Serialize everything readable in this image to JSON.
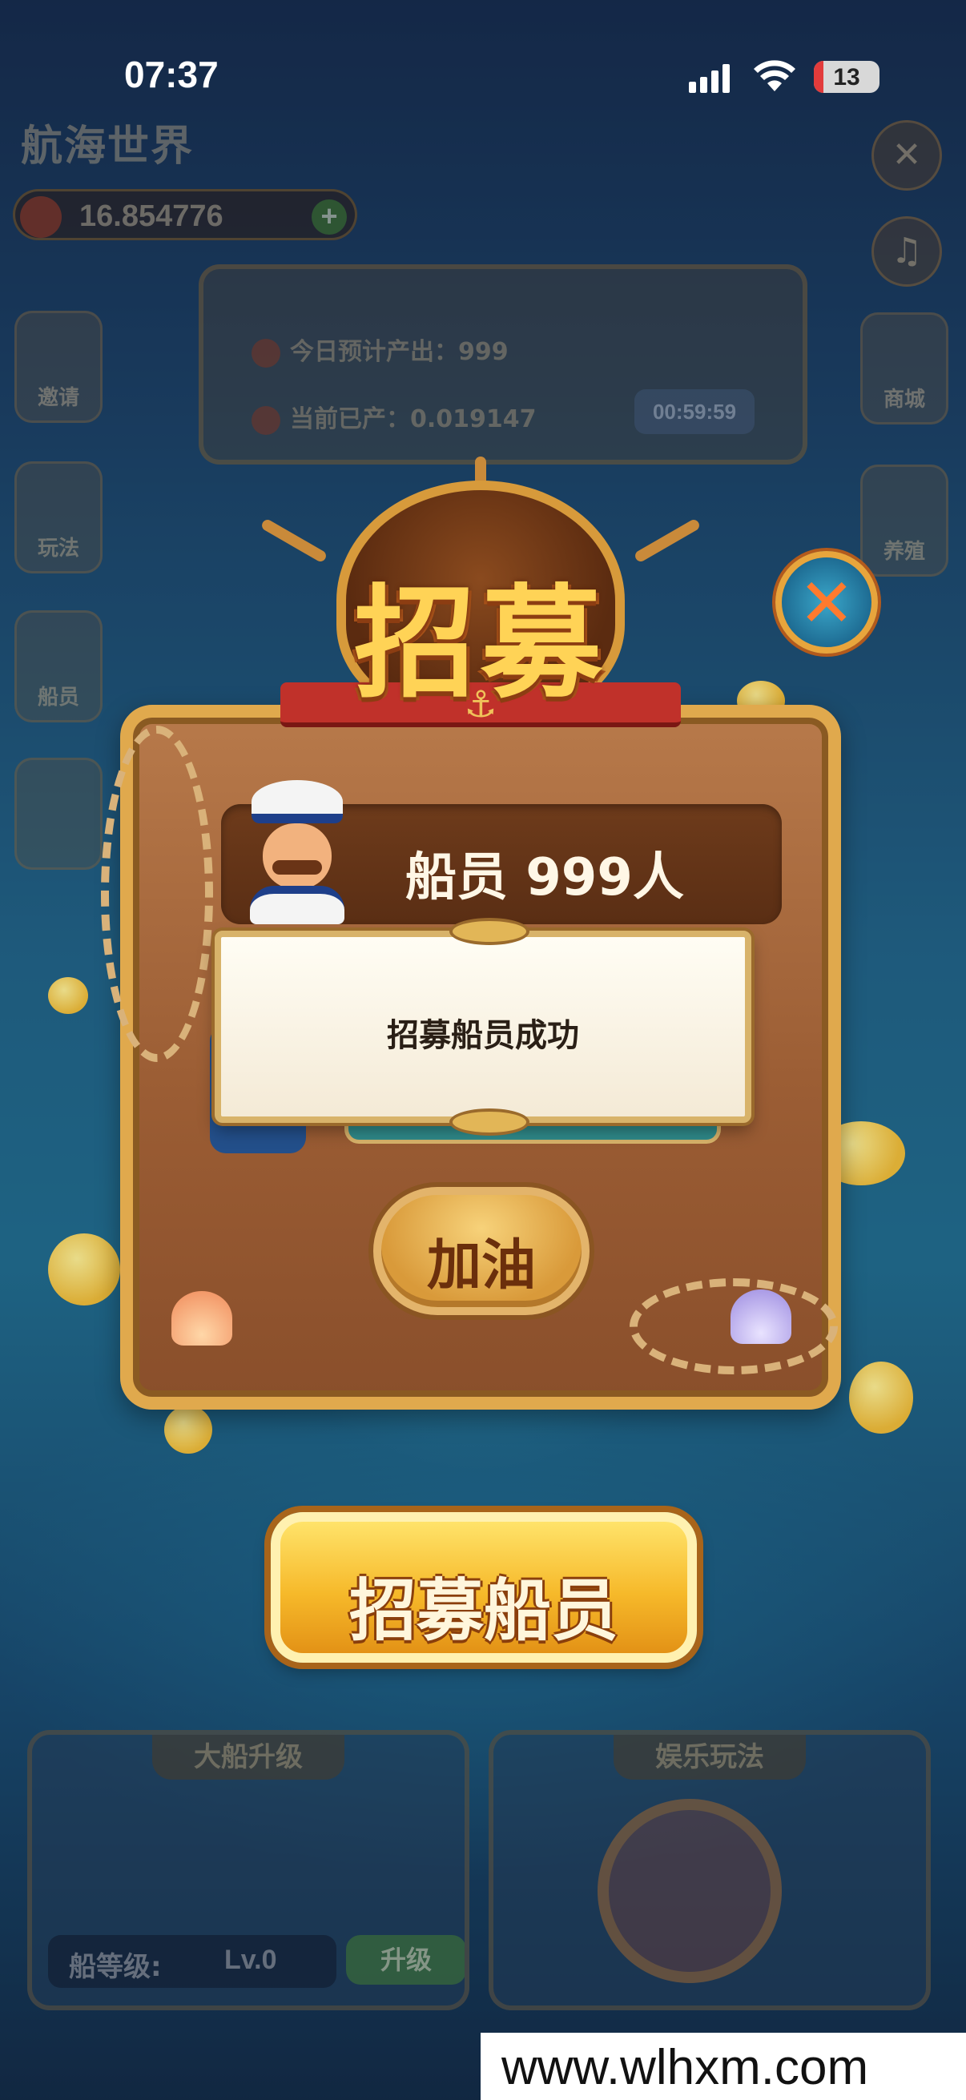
{
  "status_bar": {
    "time": "07:37",
    "battery": "13"
  },
  "background": {
    "title": "航海世界",
    "balance": "16.854776",
    "left_buttons": [
      "邀请",
      "玩法",
      "船员",
      ""
    ],
    "right_buttons": [
      "商城",
      "养殖"
    ],
    "production": {
      "daily_label": "今日预计产出：999",
      "produced_label": "当前已产：0.019147",
      "timer": "00:59:59"
    },
    "ship_card": {
      "title": "大船升级",
      "level_label": "船等级:",
      "level_value": "Lv.0",
      "upgrade": "升级"
    },
    "fun_card": {
      "title": "娱乐玩法"
    }
  },
  "modal": {
    "title": "招募",
    "crew_count": "船员 999人",
    "toast": "招募船员成功",
    "cheer_button": "加油"
  },
  "recruit_button": "招募船员",
  "watermark": "www.wlhxm.com",
  "colors": {
    "gold": "#ffd356",
    "wood": "#9b5d34",
    "teal": "#2f8a8a",
    "close_orange": "#ff7a2e"
  }
}
